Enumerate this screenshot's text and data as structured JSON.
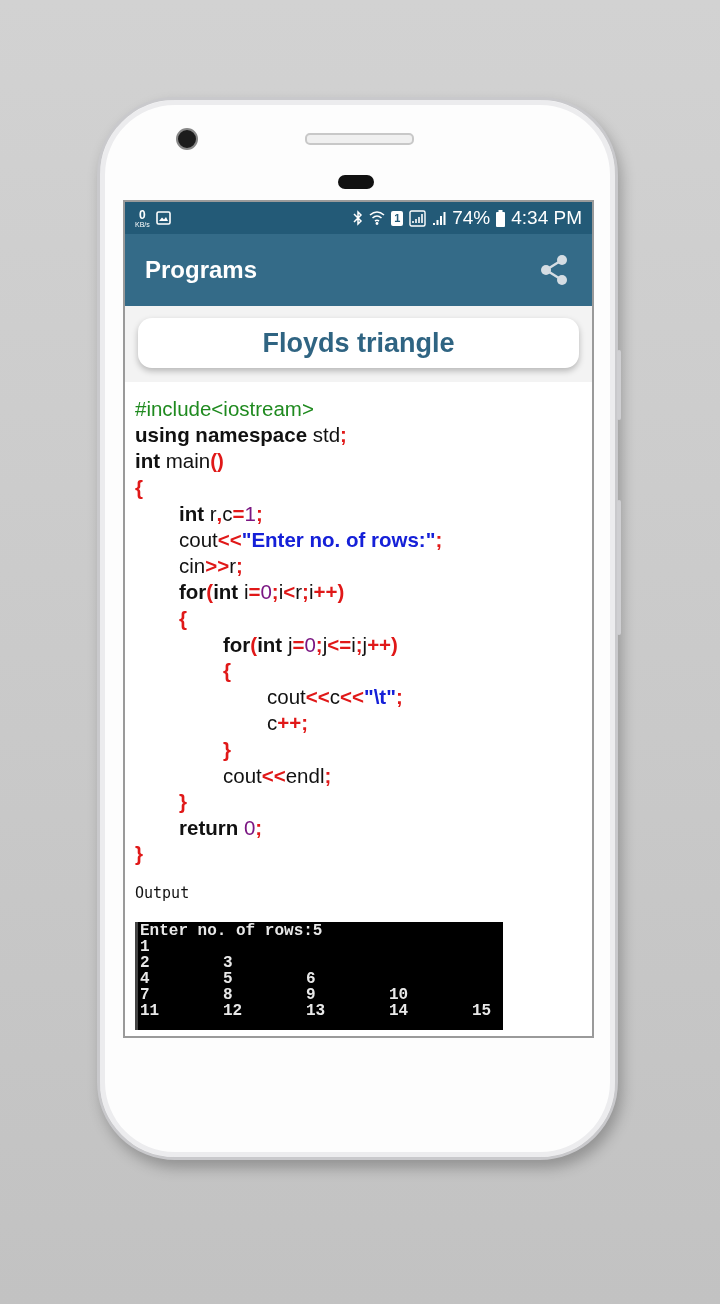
{
  "status_bar": {
    "data_speed": "0",
    "data_unit": "KB/s",
    "sim_number": "1",
    "battery": "74%",
    "time": "4:34 PM"
  },
  "app_bar": {
    "title": "Programs"
  },
  "program": {
    "title": "Floyds triangle"
  },
  "code": [
    {
      "tokens": [
        {
          "kind": "pre",
          "text": "#include<iostream>"
        }
      ]
    },
    {
      "tokens": [
        {
          "kind": "kw",
          "text": "using namespace"
        },
        {
          "kind": "id",
          "text": " std"
        },
        {
          "kind": "op",
          "text": ";"
        }
      ]
    },
    {
      "tokens": [
        {
          "kind": "kw",
          "text": "int"
        },
        {
          "kind": "id",
          "text": " main"
        },
        {
          "kind": "op",
          "text": "()"
        }
      ]
    },
    {
      "tokens": [
        {
          "kind": "op",
          "text": "{"
        }
      ],
      "children": [
        {
          "tokens": [
            {
              "kind": "kw",
              "text": "int"
            },
            {
              "kind": "id",
              "text": " r"
            },
            {
              "kind": "op",
              "text": ","
            },
            {
              "kind": "id",
              "text": "c"
            },
            {
              "kind": "op",
              "text": "="
            },
            {
              "kind": "num",
              "text": "1"
            },
            {
              "kind": "op",
              "text": ";"
            }
          ]
        },
        {
          "tokens": [
            {
              "kind": "id",
              "text": "cout"
            },
            {
              "kind": "op",
              "text": "<<"
            },
            {
              "kind": "str",
              "text": "\"Enter no. of rows:\""
            },
            {
              "kind": "op",
              "text": ";"
            }
          ]
        },
        {
          "tokens": [
            {
              "kind": "id",
              "text": "cin"
            },
            {
              "kind": "op",
              "text": ">>"
            },
            {
              "kind": "id",
              "text": "r"
            },
            {
              "kind": "op",
              "text": ";"
            }
          ]
        },
        {
          "tokens": [
            {
              "kind": "kw",
              "text": "for"
            },
            {
              "kind": "op",
              "text": "("
            },
            {
              "kind": "kw",
              "text": "int"
            },
            {
              "kind": "id",
              "text": " i"
            },
            {
              "kind": "op",
              "text": "="
            },
            {
              "kind": "num",
              "text": "0"
            },
            {
              "kind": "op",
              "text": ";"
            },
            {
              "kind": "id",
              "text": "i"
            },
            {
              "kind": "op",
              "text": "<"
            },
            {
              "kind": "id",
              "text": "r"
            },
            {
              "kind": "op",
              "text": ";"
            },
            {
              "kind": "id",
              "text": "i"
            },
            {
              "kind": "op",
              "text": "++)"
            }
          ]
        },
        {
          "tokens": [
            {
              "kind": "op",
              "text": "{"
            }
          ],
          "children": [
            {
              "tokens": [
                {
                  "kind": "kw",
                  "text": "for"
                },
                {
                  "kind": "op",
                  "text": "("
                },
                {
                  "kind": "kw",
                  "text": "int"
                },
                {
                  "kind": "id",
                  "text": " j"
                },
                {
                  "kind": "op",
                  "text": "="
                },
                {
                  "kind": "num",
                  "text": "0"
                },
                {
                  "kind": "op",
                  "text": ";"
                },
                {
                  "kind": "id",
                  "text": "j"
                },
                {
                  "kind": "op",
                  "text": "<="
                },
                {
                  "kind": "id",
                  "text": "i"
                },
                {
                  "kind": "op",
                  "text": ";"
                },
                {
                  "kind": "id",
                  "text": "j"
                },
                {
                  "kind": "op",
                  "text": "++)"
                }
              ]
            },
            {
              "tokens": [
                {
                  "kind": "op",
                  "text": "{"
                }
              ],
              "children": [
                {
                  "tokens": [
                    {
                      "kind": "id",
                      "text": "cout"
                    },
                    {
                      "kind": "op",
                      "text": "<<"
                    },
                    {
                      "kind": "id",
                      "text": "c"
                    },
                    {
                      "kind": "op",
                      "text": "<<"
                    },
                    {
                      "kind": "str",
                      "text": "\"\\t\""
                    },
                    {
                      "kind": "op",
                      "text": ";"
                    }
                  ]
                },
                {
                  "tokens": [
                    {
                      "kind": "id",
                      "text": "c"
                    },
                    {
                      "kind": "op",
                      "text": "++;"
                    }
                  ]
                }
              ]
            },
            {
              "tokens": [
                {
                  "kind": "op",
                  "text": "}"
                }
              ]
            },
            {
              "tokens": [
                {
                  "kind": "id",
                  "text": "cout"
                },
                {
                  "kind": "op",
                  "text": "<<"
                },
                {
                  "kind": "id",
                  "text": "endl"
                },
                {
                  "kind": "op",
                  "text": ";"
                }
              ]
            }
          ]
        },
        {
          "tokens": [
            {
              "kind": "op",
              "text": "}"
            }
          ]
        },
        {
          "tokens": [
            {
              "kind": "kw",
              "text": "return"
            },
            {
              "kind": "num",
              "text": " 0"
            },
            {
              "kind": "op",
              "text": ";"
            }
          ]
        }
      ]
    },
    {
      "tokens": [
        {
          "kind": "op",
          "text": "}"
        }
      ]
    }
  ],
  "output_label": "Output",
  "console": {
    "prompt": "Enter no. of rows:5",
    "rows": [
      [
        "1"
      ],
      [
        "2",
        "3"
      ],
      [
        "4",
        "5",
        "6"
      ],
      [
        "7",
        "8",
        "9",
        "10"
      ],
      [
        "11",
        "12",
        "13",
        "14",
        "15"
      ]
    ]
  }
}
